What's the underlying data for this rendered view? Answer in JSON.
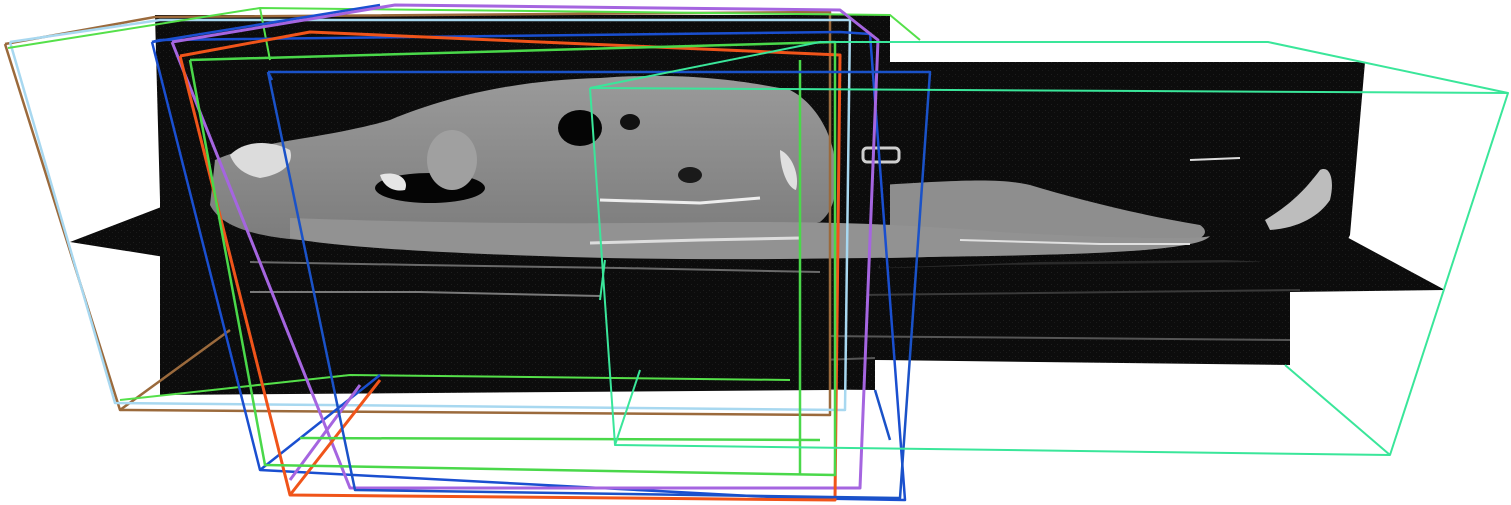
{
  "viewer": {
    "background": "#ffffff",
    "slice_colors": {
      "dark": "#0a0a0a",
      "tissue": "#8a8a8a",
      "bright": "#c8c8c8",
      "bone": "#eeeeee",
      "air": "#050505"
    },
    "bounding_boxes": [
      {
        "name": "box-brown",
        "color": "#9b6a3c"
      },
      {
        "name": "box-lightblue",
        "color": "#a8d8f0"
      },
      {
        "name": "box-green-left",
        "color": "#55e04a"
      },
      {
        "name": "box-blue-1",
        "color": "#1a4fd0"
      },
      {
        "name": "box-purple",
        "color": "#a565e0"
      },
      {
        "name": "box-orange",
        "color": "#f0541a"
      },
      {
        "name": "box-green-center",
        "color": "#4ad84a"
      },
      {
        "name": "box-blue-2",
        "color": "#1a52c8"
      },
      {
        "name": "box-teal-right",
        "color": "#3ae69a"
      }
    ]
  }
}
